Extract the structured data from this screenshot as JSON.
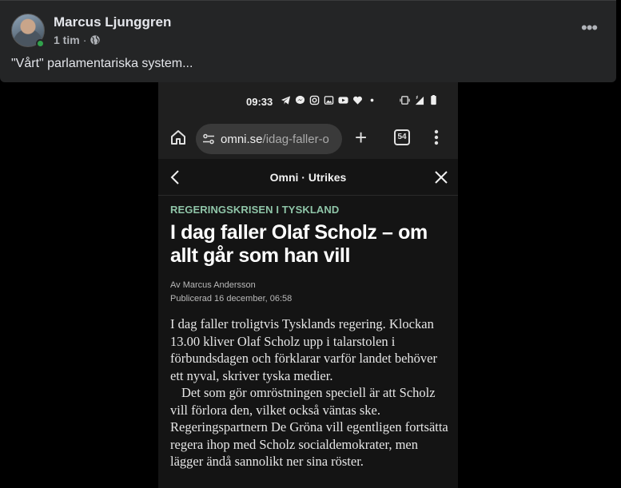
{
  "post": {
    "author": "Marcus Ljunggren",
    "time": "1 tim",
    "separator": "·",
    "audience_icon": "globe-icon",
    "text": "\"Vårt\" parlamentariska system...",
    "more_icon": "more-options-icon",
    "more_glyph": "•••"
  },
  "phone": {
    "status_time": "09:33",
    "status_icons": [
      "telegram-icon",
      "messenger-icon",
      "instagram-icon",
      "gallery-icon",
      "youtube-icon",
      "heart-icon",
      "dot-icon"
    ],
    "tab_count": "54",
    "url_domain": "omni.se",
    "url_path": "/idag-faller-o",
    "plus_glyph": "+"
  },
  "article": {
    "app_title": "Omni · Utrikes",
    "kicker": "REGERINGSKRISEN I TYSKLAND",
    "headline": "I dag faller Olaf Scholz – om allt går som han vill",
    "author_line": "Av Marcus Andersson",
    "published_line": "Publicerad 16 december, 06:58",
    "paragraph1": "I dag faller troligtvis Tysklands regering. Klockan 13.00 kliver Olaf Scholz upp i talarstolen i förbundsdagen och förklarar varför landet behöver ett nyval, skriver tyska medier.",
    "paragraph2": "Det som gör omröstningen speciell är att Scholz vill förlora den, vilket också väntas ske. Regeringspartnern De Gröna vill egentligen fortsätta regera ihop med Scholz socialdemokrater, men lägger ändå sannolikt ner sina röster."
  },
  "colors": {
    "post_bg": "#242526",
    "kicker": "#8fc5a8",
    "online": "#31a24c"
  }
}
